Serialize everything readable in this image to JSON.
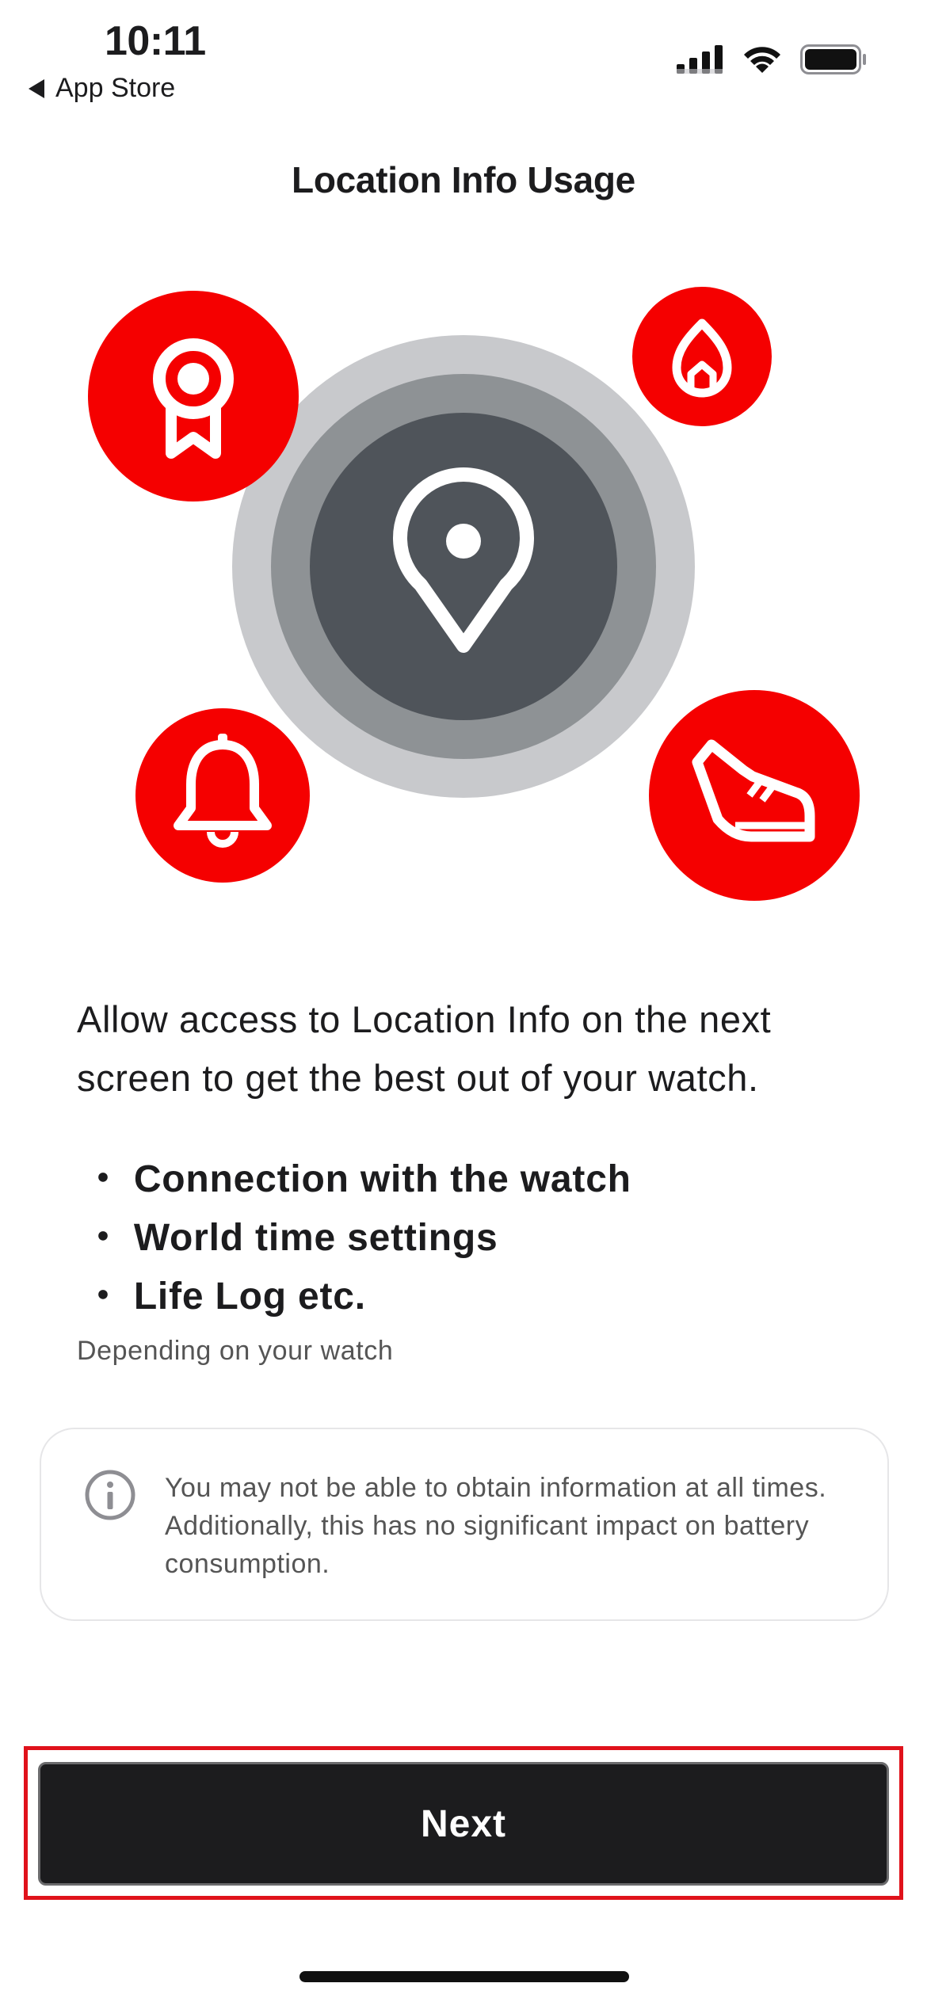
{
  "status_bar": {
    "time": "10:11",
    "back_label": "App Store"
  },
  "header": {
    "title": "Location Info Usage"
  },
  "illustration": {
    "center_icon": "map-pin-icon",
    "feature_icons": [
      "award-ribbon-icon",
      "flame-home-icon",
      "bell-icon",
      "running-shoe-icon"
    ],
    "colors": {
      "accent": "#f50000",
      "ring_outer": "#c8c9cc",
      "ring_middle": "#8e9295",
      "ring_inner": "#4f545a"
    }
  },
  "content": {
    "intro": "Allow access to Location Info on the next screen to get the best out of your watch.",
    "bullets": [
      "Connection with the watch",
      "World time settings",
      "Life Log etc."
    ],
    "bullet_marker": "・",
    "depending_note": "Depending on your watch"
  },
  "info_card": {
    "icon": "info-icon",
    "text": "You may not be able to obtain information at all times. Additionally, this has no significant impact on battery consumption."
  },
  "footer": {
    "next_label": "Next"
  }
}
